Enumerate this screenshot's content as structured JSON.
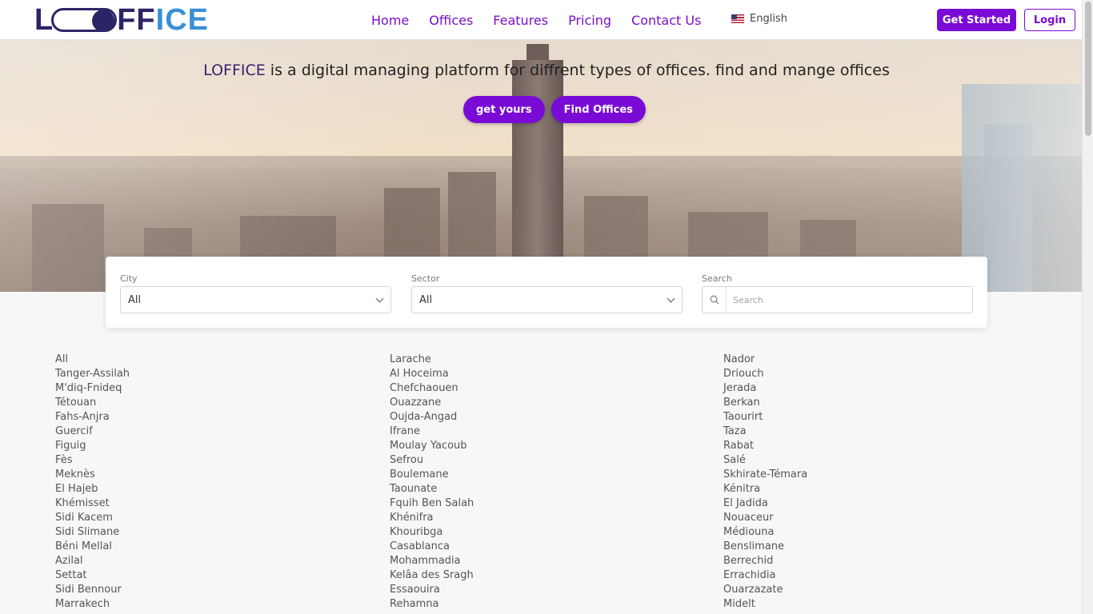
{
  "header": {
    "logo_text": "LOFFICE",
    "nav": [
      "Home",
      "Offices",
      "Features",
      "Pricing",
      "Contact Us"
    ],
    "language": "English",
    "get_started": "Get Started",
    "login": "Login"
  },
  "hero": {
    "brand": "LOFFICE",
    "tagline": " is a digital managing platform for diffrent types of offices. find and mange offices",
    "btn_get_yours": "get yours",
    "btn_find_offices": "Find Offices"
  },
  "filters": {
    "city_label": "City",
    "city_value": "All",
    "sector_label": "Sector",
    "sector_value": "All",
    "search_label": "Search",
    "search_placeholder": "Search"
  },
  "cities": {
    "col1": [
      "All",
      "Tanger-Assilah",
      "M'diq-Fnideq",
      "Tétouan",
      "Fahs-Anjra",
      "Guercif",
      "Figuig",
      "Fès",
      "Meknès",
      "El Hajeb",
      "Khémisset",
      "Sidi Kacem",
      "Sidi Slimane",
      "Béni Mellal",
      "Azilal",
      "Settat",
      "Sidi Bennour",
      "Marrakech"
    ],
    "col2": [
      "Larache",
      "Al Hoceima",
      "Chefchaouen",
      "Ouazzane",
      "Oujda-Angad",
      "Ifrane",
      "Moulay Yacoub",
      "Sefrou",
      "Boulemane",
      "Taounate",
      "Fquih Ben Salah",
      "Khénifra",
      "Khouribga",
      "Casablanca",
      "Mohammadia",
      "Kelâa des Sragh",
      "Essaouira",
      "Rehamna"
    ],
    "col3": [
      "Nador",
      "Driouch",
      "Jerada",
      "Berkan",
      "Taourirt",
      "Taza",
      "Rabat",
      "Salé",
      "Skhirate-Témara",
      "Kénitra",
      "El Jadida",
      "Nouaceur",
      "Médiouna",
      "Benslimane",
      "Berrechid",
      "Errachidia",
      "Ouarzazate",
      "Midelt"
    ]
  },
  "colors": {
    "accent": "#7a0bd6",
    "brand_dark": "#2b2566",
    "brand_blue": "#3a8fd6"
  }
}
